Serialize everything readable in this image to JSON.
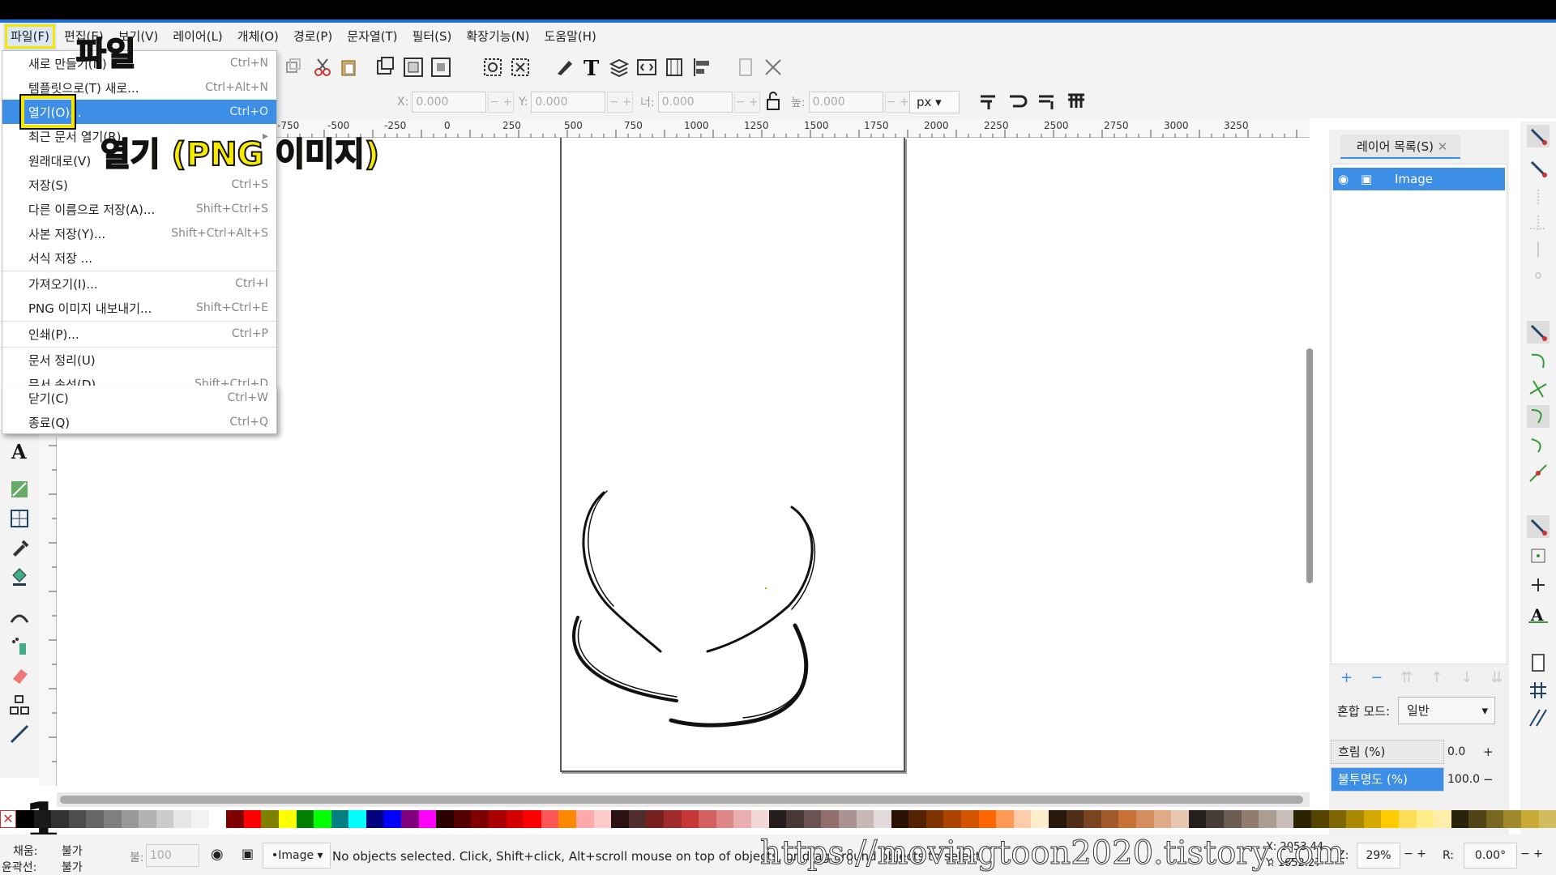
{
  "menubar": {
    "items": [
      "파일(F)",
      "편집(E)",
      "보기(V)",
      "레이어(L)",
      "개체(O)",
      "경로(P)",
      "문자열(T)",
      "필터(S)",
      "확장기능(N)",
      "도움말(H)"
    ]
  },
  "file_menu": {
    "items": [
      {
        "label": "새로 만들기(N)",
        "shortcut": "Ctrl+N"
      },
      {
        "label": "템플릿으로(T) 새로...",
        "shortcut": "Ctrl+Alt+N"
      },
      {
        "label": "열기(O)...",
        "shortcut": "Ctrl+O"
      },
      {
        "label": "최근 문서 열기(R)",
        "shortcut": ""
      },
      {
        "label": "원래대로(V)",
        "shortcut": ""
      },
      {
        "label": "저장(S)",
        "shortcut": "Ctrl+S"
      },
      {
        "label": "다른 이름으로 저장(A)...",
        "shortcut": "Shift+Ctrl+S"
      },
      {
        "label": "사본 저장(Y)...",
        "shortcut": "Shift+Ctrl+Alt+S"
      },
      {
        "label": "서식 저장 ...",
        "shortcut": ""
      },
      {
        "label": "가져오기(I)...",
        "shortcut": "Ctrl+I"
      },
      {
        "label": "PNG 이미지 내보내기...",
        "shortcut": "Shift+Ctrl+E"
      },
      {
        "label": "인쇄(P)...",
        "shortcut": "Ctrl+P"
      },
      {
        "label": "문서 정리(U)",
        "shortcut": ""
      },
      {
        "label": "문서 속성(D)...",
        "shortcut": "Shift+Ctrl+D"
      },
      {
        "label": "닫기(C)",
        "shortcut": "Ctrl+W"
      },
      {
        "label": "종료(Q)",
        "shortcut": "Ctrl+Q"
      }
    ]
  },
  "callouts": {
    "file": "파일",
    "open": "열기 (PNG 이미지)",
    "step": "1"
  },
  "toolbar": {
    "x_label": "X:",
    "x_value": "0.000",
    "y_label": "Y:",
    "y_value": "0.000",
    "w_label": "너:",
    "w_value": "0.000",
    "h_label": "높:",
    "h_value": "0.000",
    "unit": "px"
  },
  "ruler_ticks": [
    "-750",
    "-500",
    "-250",
    "0",
    "250",
    "500",
    "750",
    "1000",
    "1250",
    "1500",
    "1750",
    "2000",
    "2250",
    "2500",
    "2750",
    "3000",
    "3250"
  ],
  "layers_panel": {
    "tab_label": "레이어 목록(S)",
    "layer_name": "Image",
    "blend_label": "혼합 모드:",
    "blend_value": "일반",
    "blur_label": "흐림 (%)",
    "blur_value": "0.0",
    "opacity_label": "불투명도 (%)",
    "opacity_value": "100.0"
  },
  "status": {
    "fill_label": "채움:",
    "fill_value": "불가",
    "stroke_label": "윤곽선:",
    "stroke_value": "불가",
    "opacity_label": "불:",
    "opacity_value": "100",
    "layer_select": "•Image",
    "message": "No objects selected. Click, Shift+click, Alt+scroll mouse on top of objects, or drag around objects to select.",
    "cursor_x": "2053.44",
    "cursor_y": "1652.27",
    "zoom_label": "Z:",
    "zoom_value": "29%",
    "rotate_label": "R:",
    "rotate_value": "0.00°"
  },
  "watermark": "https://movingtoon2020.tistory.com",
  "colors": {
    "accent": "#3d8ee6",
    "highlight": "#f3e600"
  }
}
